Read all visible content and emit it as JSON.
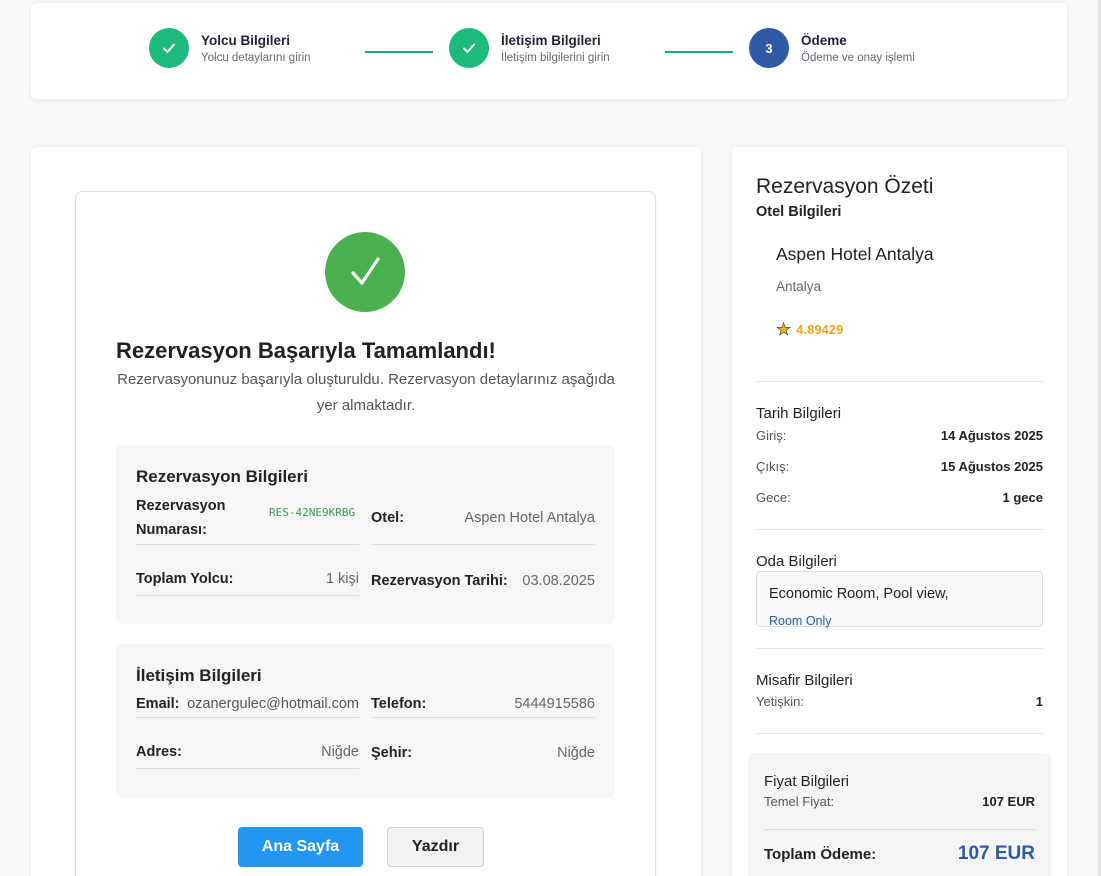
{
  "stepper": {
    "steps": [
      {
        "title": "Yolcu Bilgileri",
        "subtitle": "Yolcu detaylarını girin",
        "state": "done",
        "icon": "check-icon"
      },
      {
        "title": "İletişim Bilgileri",
        "subtitle": "İletişim bilgilerini girin",
        "state": "done",
        "icon": "check-icon"
      },
      {
        "title": "Ödeme",
        "subtitle": "Ödeme ve onay işlemi",
        "state": "active",
        "number": "3"
      }
    ]
  },
  "success": {
    "icon": "checkmark-icon",
    "title": "Rezervasyon Başarıyla Tamamlandı!",
    "description": "Rezervasyonunuz başarıyla oluşturuldu. Rezervasyon detaylarınız aşağıda yer almaktadır.",
    "reservation": {
      "heading": "Rezervasyon Bilgileri",
      "number_label": "Rezervasyon Numarası:",
      "number_value": "RES-42NE9KRBG",
      "hotel_label": "Otel:",
      "hotel_value": "Aspen Hotel Antalya",
      "passengers_label": "Toplam Yolcu:",
      "passengers_value": "1 kişi",
      "date_label": "Rezervasyon Tarihi:",
      "date_value": "03.08.2025"
    },
    "contact": {
      "heading": "İletişim Bilgileri",
      "email_label": "Email:",
      "email_value": "ozanergulec@hotmail.com",
      "phone_label": "Telefon:",
      "phone_value": "5444915586",
      "address_label": "Adres:",
      "address_value": "Niğde",
      "city_label": "Şehir:",
      "city_value": "Niğde"
    },
    "buttons": {
      "home": "Ana Sayfa",
      "print": "Yazdır"
    }
  },
  "summary": {
    "title": "Rezervasyon Özeti",
    "hotel_section": "Otel Bilgileri",
    "hotel_name": "Aspen Hotel Antalya",
    "hotel_city": "Antalya",
    "rating_icon": "star-icon",
    "rating": "4.89429",
    "dates": {
      "heading": "Tarih Bilgileri",
      "checkin_label": "Giriş:",
      "checkin_value": "14 Ağustos 2025",
      "checkout_label": "Çıkış:",
      "checkout_value": "15 Ağustos 2025",
      "nights_label": "Gece:",
      "nights_value": "1 gece"
    },
    "room": {
      "heading": "Oda Bilgileri",
      "name": "Economic Room, Pool view,",
      "board": "Room Only"
    },
    "guests": {
      "heading": "Misafir Bilgileri",
      "adults_label": "Yetişkin:",
      "adults_value": "1"
    },
    "price": {
      "heading": "Fiyat Bilgileri",
      "base_label": "Temel Fiyat:",
      "base_value": "107 EUR",
      "total_label": "Toplam Ödeme:",
      "total_value": "107 EUR"
    }
  },
  "colors": {
    "step_done": "#1dba7d",
    "step_active": "#2d5aa3",
    "success": "#4cb050",
    "primary_button": "#2196f3",
    "rating": "#f0a41e",
    "price_total": "#2d5aa3"
  }
}
